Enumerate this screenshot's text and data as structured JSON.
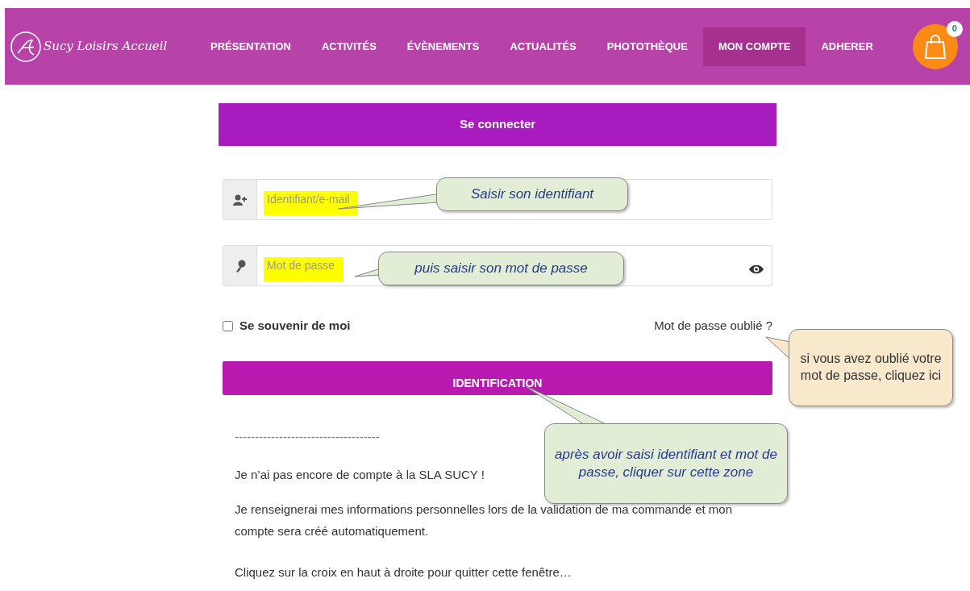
{
  "brand": {
    "name": "Sucy Loisirs Accueil"
  },
  "nav": [
    {
      "label": "PRÉSENTATION",
      "selected": false
    },
    {
      "label": "ACTIVITÉS",
      "selected": false
    },
    {
      "label": "ÉVÈNEMENTS",
      "selected": false
    },
    {
      "label": "ACTUALITÉS",
      "selected": false
    },
    {
      "label": "PHOTOTHÈQUE",
      "selected": false
    },
    {
      "label": "MON COMPTE",
      "selected": true
    },
    {
      "label": "ADHERER",
      "selected": false
    }
  ],
  "cart": {
    "count": "0"
  },
  "login": {
    "title": "Se connecter",
    "fields": [
      {
        "kind": "user",
        "placeholder": "Identifiant/e-mail",
        "highlighted": true
      },
      {
        "kind": "password",
        "placeholder": "Mot de passe",
        "highlighted": true
      }
    ],
    "remember": {
      "label": "Se souvenir de moi",
      "checked": false
    },
    "forgot": "Mot de passe oublié ?",
    "submit": "IDENTIFICATION",
    "separator": "------------------------------------",
    "paragraphs": [
      "Je n’ai pas encore de compte à la SLA SUCY !",
      "Je renseignerai mes informations personnelles lors de la validation de ma commande et mon compte sera créé automatiquement.",
      "Cliquez sur la croix en haut à droite pour quitter cette fenêtre…"
    ]
  },
  "callouts": [
    {
      "text": "Saisir son identifiant",
      "color": "#e2edd5"
    },
    {
      "text": "puis saisir son mot de passe",
      "color": "#e2edd5"
    },
    {
      "text": "si vous avez oublié votre mot de passe, cliquez ici",
      "color": "#f8e9cc"
    },
    {
      "text": "après avoir saisi identifiant et mot de passe, cliquer sur cette zone",
      "color": "#e2edd5"
    }
  ]
}
